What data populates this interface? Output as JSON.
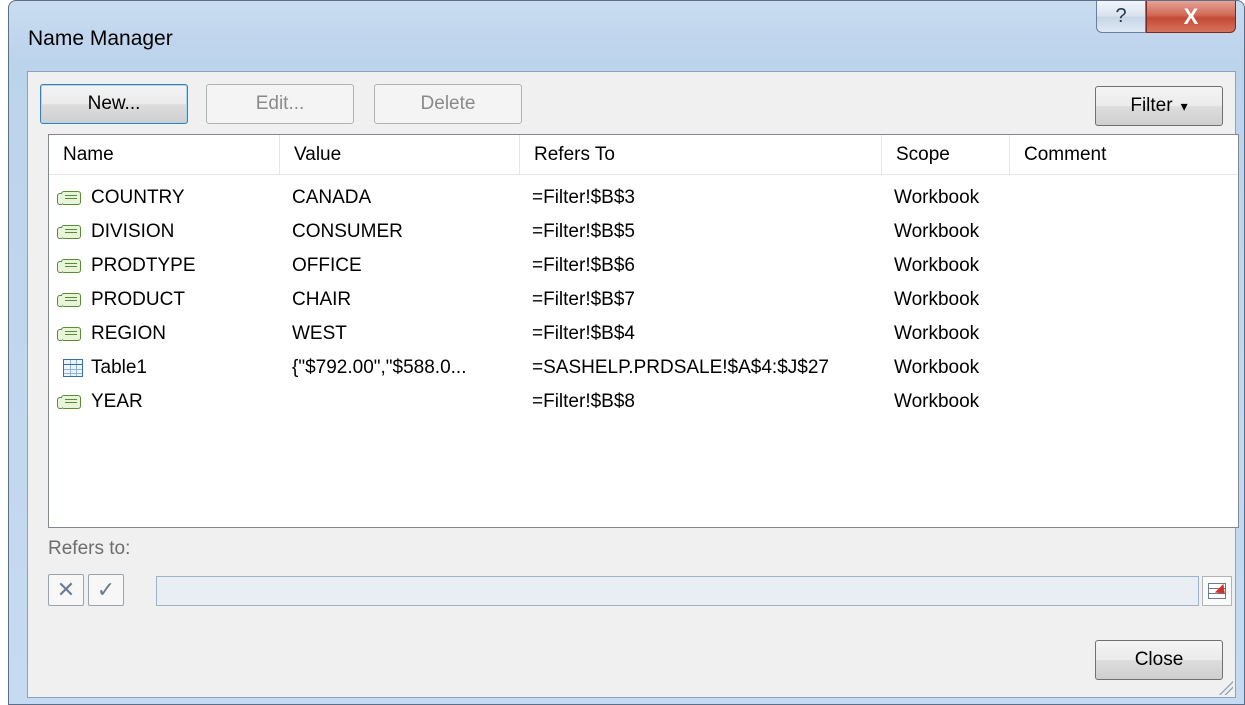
{
  "window": {
    "title": "Name Manager",
    "help_glyph": "?",
    "close_glyph": "X"
  },
  "toolbar": {
    "new_label": "New...",
    "edit_label": "Edit...",
    "delete_label": "Delete",
    "filter_label": "Filter",
    "filter_arrow": "▾"
  },
  "table": {
    "columns": [
      "Name",
      "Value",
      "Refers To",
      "Scope",
      "Comment"
    ],
    "rows": [
      {
        "icon": "named-range-icon",
        "name": "COUNTRY",
        "value": "CANADA",
        "refers_to": "=Filter!$B$3",
        "scope": "Workbook",
        "comment": ""
      },
      {
        "icon": "named-range-icon",
        "name": "DIVISION",
        "value": "CONSUMER",
        "refers_to": "=Filter!$B$5",
        "scope": "Workbook",
        "comment": ""
      },
      {
        "icon": "named-range-icon",
        "name": "PRODTYPE",
        "value": "OFFICE",
        "refers_to": "=Filter!$B$6",
        "scope": "Workbook",
        "comment": ""
      },
      {
        "icon": "named-range-icon",
        "name": "PRODUCT",
        "value": "CHAIR",
        "refers_to": "=Filter!$B$7",
        "scope": "Workbook",
        "comment": ""
      },
      {
        "icon": "named-range-icon",
        "name": "REGION",
        "value": "WEST",
        "refers_to": "=Filter!$B$4",
        "scope": "Workbook",
        "comment": ""
      },
      {
        "icon": "table-icon",
        "name": "Table1",
        "value": "{\"$792.00\",\"$588.0...",
        "refers_to": "=SASHELP.PRDSALE!$A$4:$J$27",
        "scope": "Workbook",
        "comment": ""
      },
      {
        "icon": "named-range-icon",
        "name": "YEAR",
        "value": "",
        "refers_to": "=Filter!$B$8",
        "scope": "Workbook",
        "comment": ""
      }
    ]
  },
  "refers_to": {
    "label": "Refers to:",
    "value": "",
    "cancel_glyph": "✕",
    "enter_glyph": "✓"
  },
  "footer": {
    "close_label": "Close"
  }
}
